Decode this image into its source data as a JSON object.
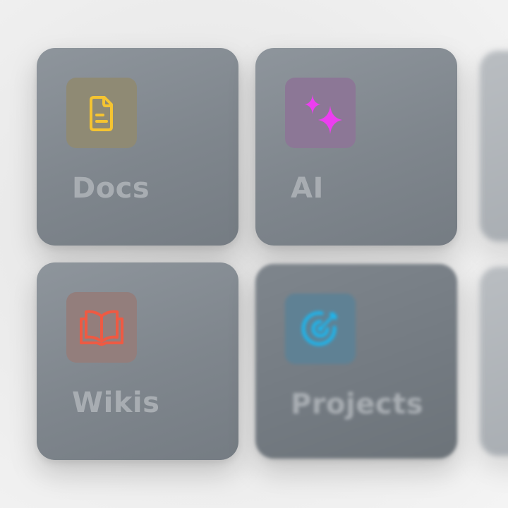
{
  "tiles": [
    {
      "label": "Docs",
      "icon": "document-icon",
      "icon_color": "#f5c431",
      "icon_bg": "#8f8a74"
    },
    {
      "label": "AI",
      "icon": "sparkles-icon",
      "icon_color": "#ec3ef0",
      "icon_bg": "#8c7796"
    },
    {
      "label": "Wikis",
      "icon": "open-book-icon",
      "icon_color": "#ee5a43",
      "icon_bg": "#937e7c"
    },
    {
      "label": "Projects",
      "icon": "target-icon",
      "icon_color": "#1cb6ee",
      "icon_bg": "#5f8194"
    }
  ]
}
